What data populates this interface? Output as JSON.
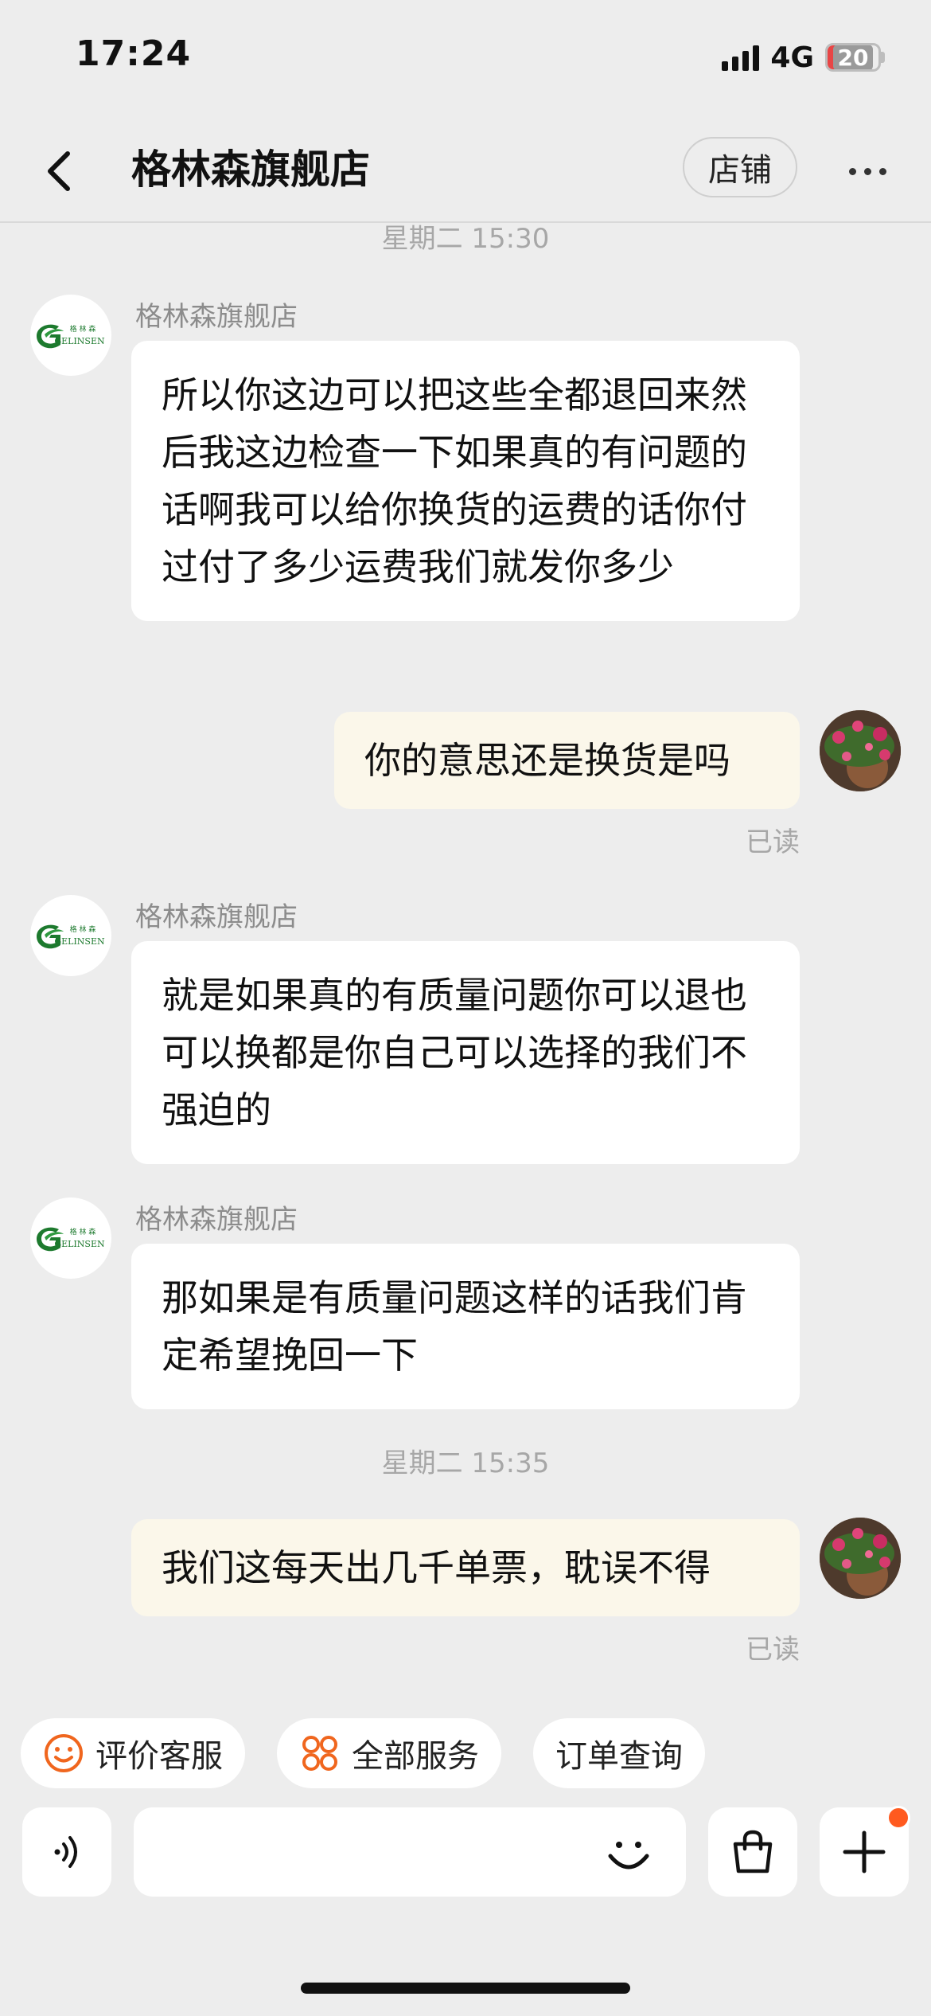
{
  "status_bar": {
    "time": "17:24",
    "network": "4G",
    "battery": "20"
  },
  "nav": {
    "title": "格林森旗舰店",
    "shop_button": "店铺"
  },
  "shop_logo": {
    "chinese": "格 林 森",
    "latin": "GELINSEN"
  },
  "messages": [
    {
      "type": "timestamp",
      "text": "星期二 15:30"
    },
    {
      "type": "incoming",
      "sender": "格林森旗舰店",
      "text": "所以你这边可以把这些全都退回来然后我这边检查一下如果真的有问题的话啊我可以给你换货的运费的话你付过付了多少运费我们就发你多少"
    },
    {
      "type": "outgoing",
      "text": "你的意思还是换货是吗",
      "status": "已读"
    },
    {
      "type": "incoming",
      "sender": "格林森旗舰店",
      "text": "就是如果真的有质量问题你可以退也可以换都是你自己可以选择的我们不强迫的"
    },
    {
      "type": "incoming",
      "sender": "格林森旗舰店",
      "text": "那如果是有质量问题这样的话我们肯定希望挽回一下"
    },
    {
      "type": "timestamp",
      "text": "星期二 15:35"
    },
    {
      "type": "outgoing",
      "text": "我们这每天出几千单票，耽误不得",
      "status": "已读"
    }
  ],
  "quick_actions": [
    {
      "label": "评价客服",
      "icon": "smiley-icon"
    },
    {
      "label": "全部服务",
      "icon": "grid-services-icon"
    },
    {
      "label": "订单查询",
      "icon": ""
    }
  ],
  "input": {
    "placeholder": "",
    "value": ""
  },
  "colors": {
    "accent": "#ff5a1f",
    "outgoing_bubble": "#fbf7ea",
    "background": "#ededed"
  }
}
